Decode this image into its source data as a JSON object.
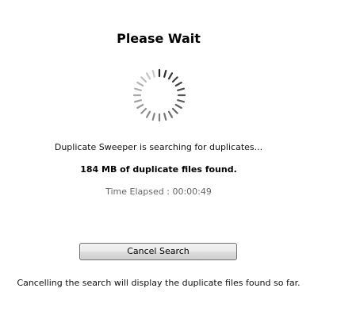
{
  "dialog": {
    "title": "Please Wait",
    "spinner_icon": "loading-spinner-icon",
    "status_message": "Duplicate Sweeper is searching for duplicates...",
    "found_message": "184 MB of duplicate files found.",
    "time_elapsed": "Time Elapsed : 00:00:49",
    "cancel_label": "Cancel Search",
    "cancel_note": "Cancelling the search will display the duplicate files found so far."
  }
}
